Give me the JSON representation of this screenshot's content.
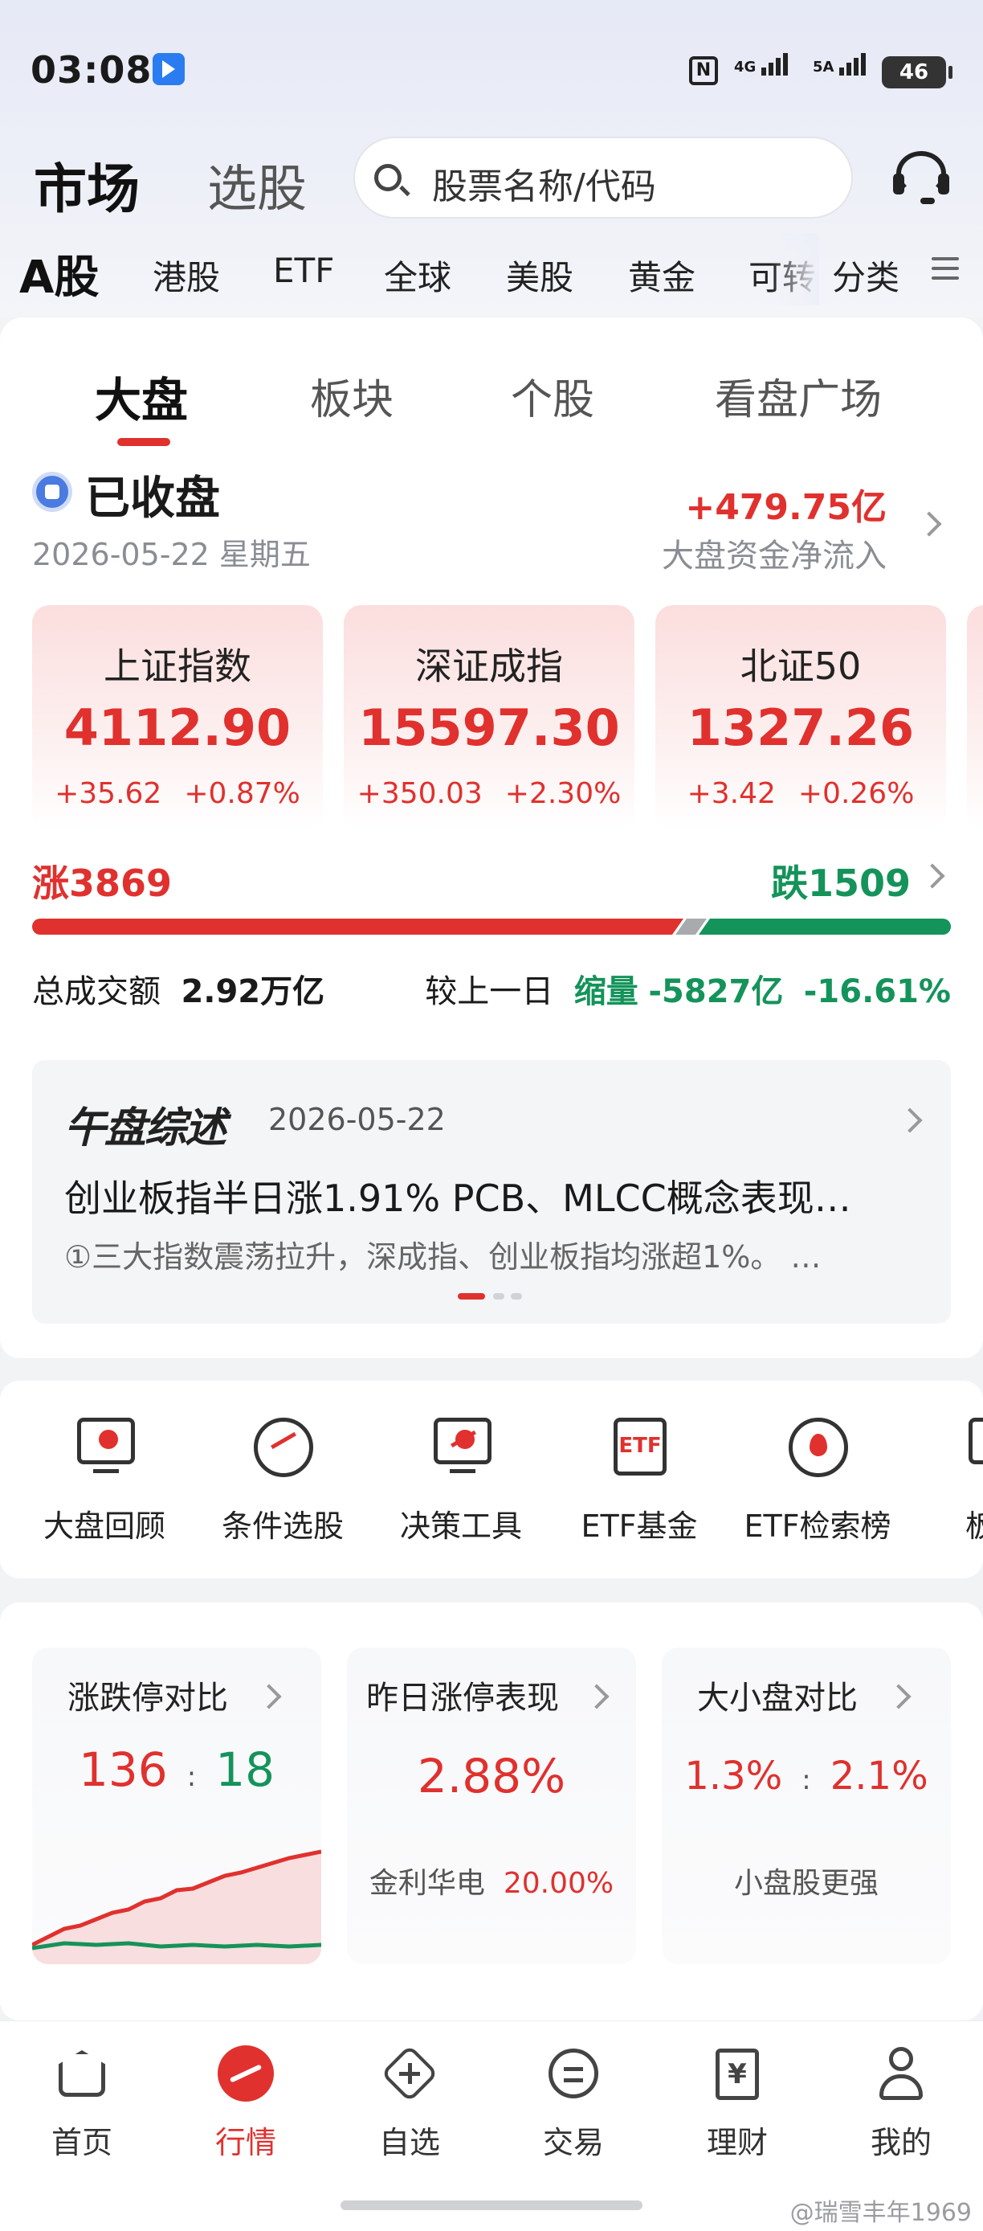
{
  "status": {
    "time": "03:08",
    "net1": "4G",
    "net2": "5A",
    "battery": "46"
  },
  "header": {
    "tab_market": "市场",
    "tab_pick": "选股",
    "search_placeholder": "股票名称/代码"
  },
  "categories": [
    "A股",
    "港股",
    "ETF",
    "全球",
    "美股",
    "黄金",
    "可转",
    "分类"
  ],
  "subtabs": [
    "大盘",
    "板块",
    "个股",
    "看盘广场"
  ],
  "market": {
    "status": "已收盘",
    "date": "2026-05-22 星期五",
    "inflow_value": "+479.75亿",
    "inflow_label": "大盘资金净流入"
  },
  "indices": [
    {
      "name": "上证指数",
      "value": "4112.90",
      "change": "+35.62",
      "pct": "+0.87%"
    },
    {
      "name": "深证成指",
      "value": "15597.30",
      "change": "+350.03",
      "pct": "+2.30%"
    },
    {
      "name": "北证50",
      "value": "1327.26",
      "change": "+3.42",
      "pct": "+0.26%"
    }
  ],
  "breadth": {
    "up_label": "涨",
    "up_count": 3869,
    "down_label": "跌",
    "down_count": 1509,
    "up_fraction": 0.705,
    "flat_fraction": 0.02
  },
  "volume": {
    "total_label": "总成交额",
    "total_value": "2.92万亿",
    "compare_label": "较上一日",
    "trend_label": "缩量",
    "diff": "-5827亿",
    "diff_pct": "-16.61%"
  },
  "news": {
    "brand": "午盘综述",
    "date": "2026-05-22",
    "title": "创业板指半日涨1.91% PCB、MLCC概念表现…",
    "summary": "①三大指数震荡拉升，深成指、创业板指均涨超1%。 …"
  },
  "tools": [
    {
      "label": "大盘回顾",
      "icon": "market-review-icon"
    },
    {
      "label": "条件选股",
      "icon": "condition-picker-icon"
    },
    {
      "label": "决策工具",
      "icon": "decision-tool-icon"
    },
    {
      "label": "ETF基金",
      "icon": "etf-fund-icon"
    },
    {
      "label": "ETF检索榜",
      "icon": "etf-rank-icon"
    },
    {
      "label": "板块",
      "icon": "sector-icon"
    }
  ],
  "stats": {
    "limit": {
      "title": "涨跌停对比",
      "up": "136",
      "down": "18"
    },
    "yesterday": {
      "title": "昨日涨停表现",
      "value": "2.88%",
      "stock": "金利华电",
      "stock_pct": "20.00%"
    },
    "cap": {
      "title": "大小盘对比",
      "large": "1.3%",
      "small": "2.1%",
      "note": "小盘股更强"
    }
  },
  "nav": [
    "首页",
    "行情",
    "自选",
    "交易",
    "理财",
    "我的"
  ],
  "watermark": "@瑞雪丰年1969",
  "colors": {
    "up": "#e0312e",
    "down": "#14935a",
    "accent": "#e0312e"
  }
}
